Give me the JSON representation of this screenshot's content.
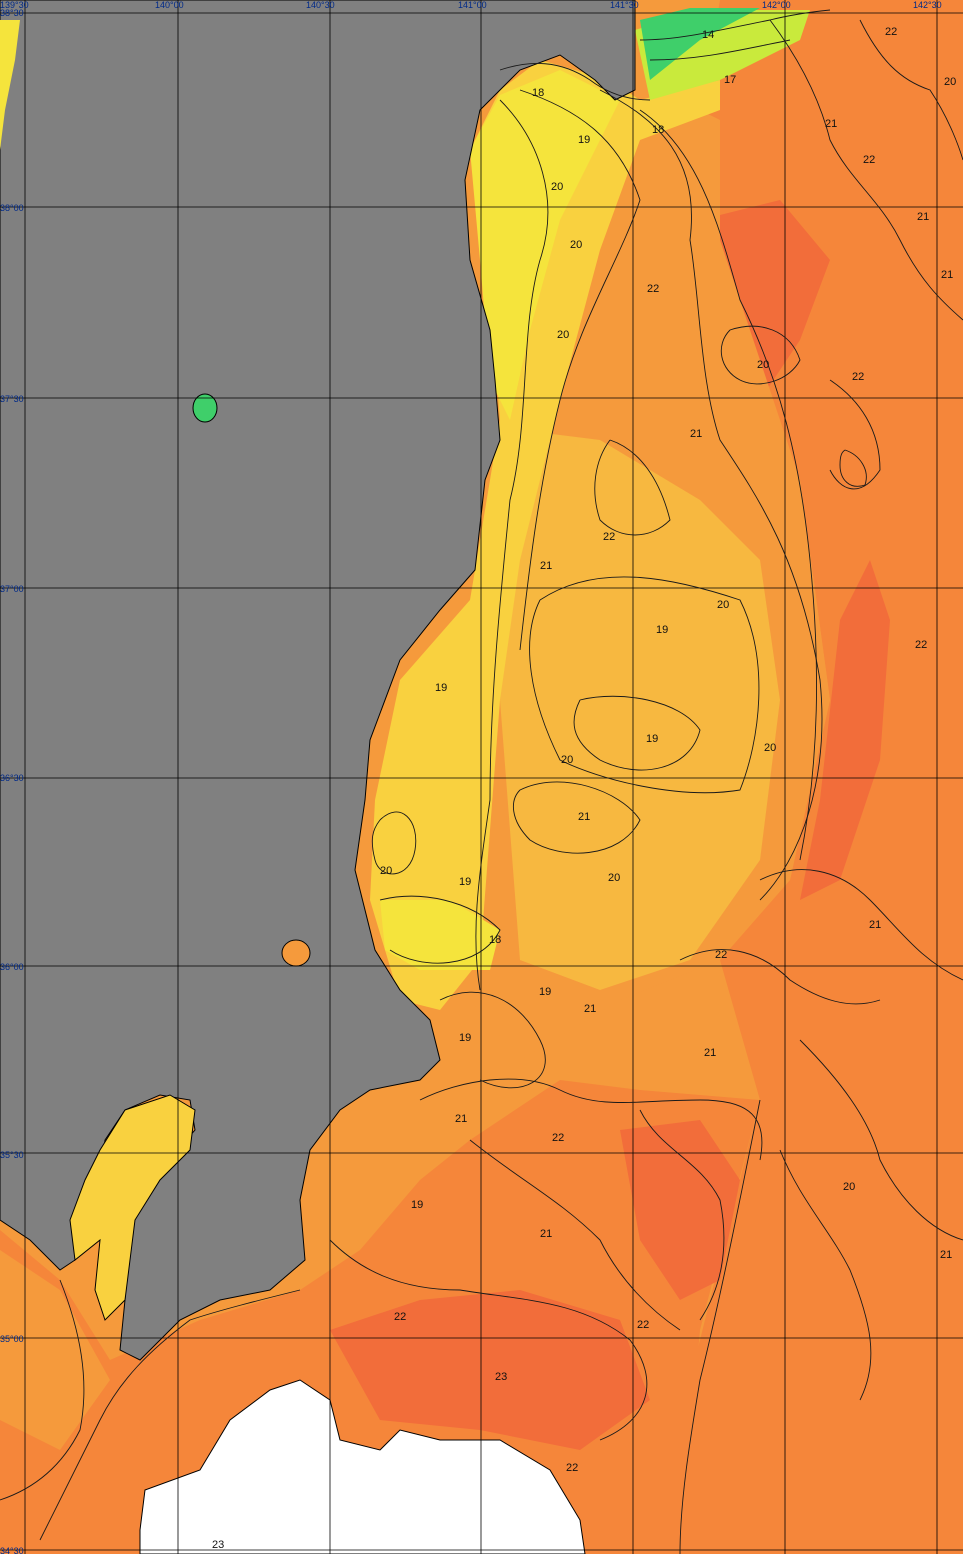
{
  "map": {
    "colors": {
      "land": "#808080",
      "no_data": "#ffffff",
      "t14": "#3fcf6a",
      "t17": "#c9ea3c",
      "t18": "#f5e43c",
      "t19": "#f9d13f",
      "t20": "#f7b840",
      "t21": "#f59a3c",
      "t22": "#f5863a",
      "t23": "#f26d3a",
      "grid": "#000000",
      "contour": "#1a1a1a"
    },
    "top_labels": [
      "139°30",
      "140°00",
      "140°30",
      "141°00",
      "141°30",
      "142°00",
      "142°30"
    ],
    "left_labels": [
      "38°30",
      "38°00",
      "37°30",
      "37°00",
      "36°30",
      "36°00",
      "35°30",
      "35°00",
      "34°30"
    ],
    "contour_labels": [
      "14",
      "17",
      "18",
      "18",
      "19",
      "20",
      "20",
      "20",
      "22",
      "21",
      "22",
      "21",
      "21",
      "20",
      "22",
      "21",
      "22",
      "22",
      "21",
      "20",
      "19",
      "19",
      "20",
      "20",
      "19",
      "21",
      "20",
      "19",
      "20",
      "18",
      "19",
      "21",
      "19",
      "21",
      "21",
      "22",
      "21",
      "22",
      "19",
      "21",
      "20",
      "21",
      "22",
      "20",
      "22",
      "23",
      "22",
      "22",
      "23"
    ]
  }
}
